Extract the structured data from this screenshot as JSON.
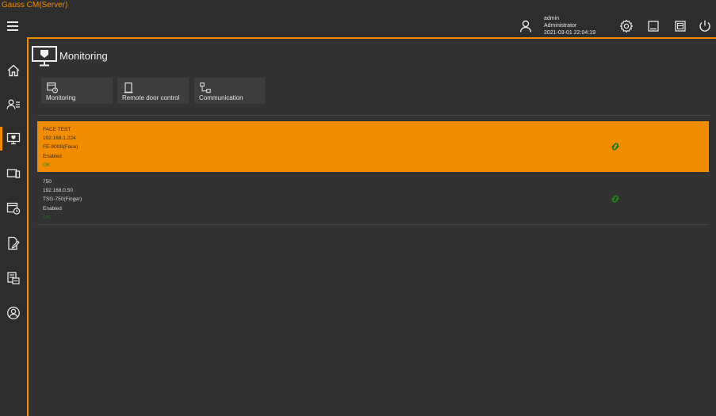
{
  "window": {
    "title": "Gauss CM(Server)"
  },
  "user": {
    "name": "admin",
    "role": "Administrator",
    "datetime": "2021-03-01 22:04:19"
  },
  "page": {
    "title": "Monitoring"
  },
  "tabs": [
    {
      "label": "Monitoring",
      "icon": "monitoring-clock-icon"
    },
    {
      "label": "Remote door control",
      "icon": "door-icon"
    },
    {
      "label": "Communication",
      "icon": "network-icon"
    }
  ],
  "devices": [
    {
      "name": "FACE TEST",
      "ip": "192.168.1.224",
      "model": "FE-800S(Face)",
      "state": "Enabled",
      "status": "OK",
      "selected": true
    },
    {
      "name": "750",
      "ip": "192.168.0.50",
      "model": "TSG-750(Finger)",
      "state": "Enabled",
      "status": "OK",
      "selected": false
    }
  ],
  "colors": {
    "accent": "#f28c00",
    "background": "#2d2d2d",
    "panel": "#323232",
    "button": "#3d3d3d",
    "ok_green": "#2a8a1c"
  },
  "sidebar_icons": [
    "home-icon",
    "users-list-icon",
    "monitor-icon",
    "device-icon",
    "schedule-icon",
    "edit-document-icon",
    "report-icon",
    "account-icon"
  ],
  "top_icons": [
    "user-icon",
    "settings-gear-icon",
    "panel-icon",
    "window-icon",
    "power-icon"
  ]
}
